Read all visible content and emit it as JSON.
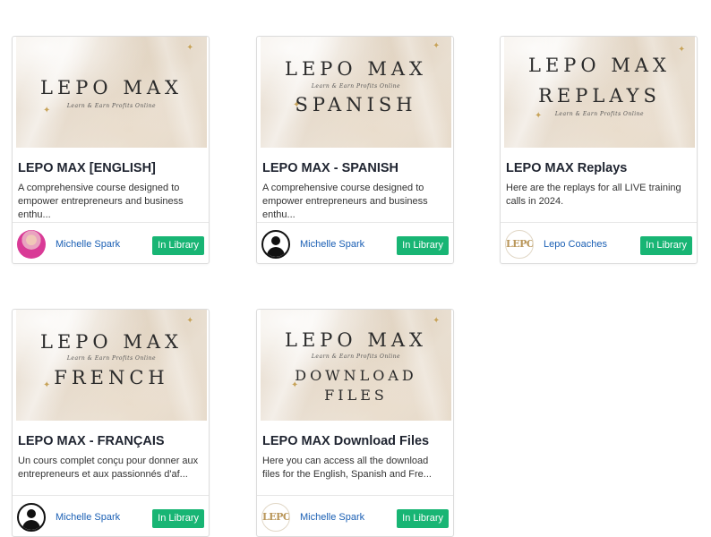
{
  "cards": [
    {
      "thumb_lines": [
        "LEPO MAX",
        "Learn & Earn Profits Online"
      ],
      "title": "LEPO MAX [ENGLISH]",
      "description": "A comprehensive course designed to empower entrepreneurs and business enthu...",
      "author": "Michelle Spark",
      "avatar": "photo-avatar",
      "badge": "In Library"
    },
    {
      "thumb_lines": [
        "LEPO MAX",
        "Learn & Earn Profits Online",
        "SPANISH"
      ],
      "title": "LEPO MAX - SPANISH",
      "description": "A comprehensive course designed to empower entrepreneurs and business enthu...",
      "author": "Michelle Spark",
      "avatar": "default-user-icon",
      "badge": "In Library"
    },
    {
      "thumb_lines": [
        "LEPO MAX",
        "REPLAYS",
        "Learn & Earn Profits Online"
      ],
      "title": "LEPO MAX Replays",
      "description": "Here are the replays for all LIVE training calls in 2024.",
      "author": "Lepo Coaches",
      "avatar": "lepo-logo",
      "avatar_text": "LEPO",
      "badge": "In Library"
    },
    {
      "thumb_lines": [
        "LEPO MAX",
        "Learn & Earn Profits Online",
        "FRENCH"
      ],
      "title": "LEPO MAX - FRANÇAIS",
      "description": "Un cours complet conçu pour donner aux entrepreneurs et aux passionnés d'af...",
      "author": "Michelle Spark",
      "avatar": "default-user-icon",
      "badge": "In Library"
    },
    {
      "thumb_lines": [
        "LEPO MAX",
        "Learn & Earn Profits Online",
        "DOWNLOAD",
        "FILES"
      ],
      "title": "LEPO MAX Download Files",
      "description": "Here you can access all the download files for the English, Spanish and Fre...",
      "author": "Michelle Spark",
      "avatar": "lepo-logo",
      "avatar_text": "LEPO",
      "badge": "In Library"
    }
  ],
  "colors": {
    "badge_green": "#18b574",
    "author_link": "#1a5fb4",
    "gold_accent": "#c7a35a"
  }
}
